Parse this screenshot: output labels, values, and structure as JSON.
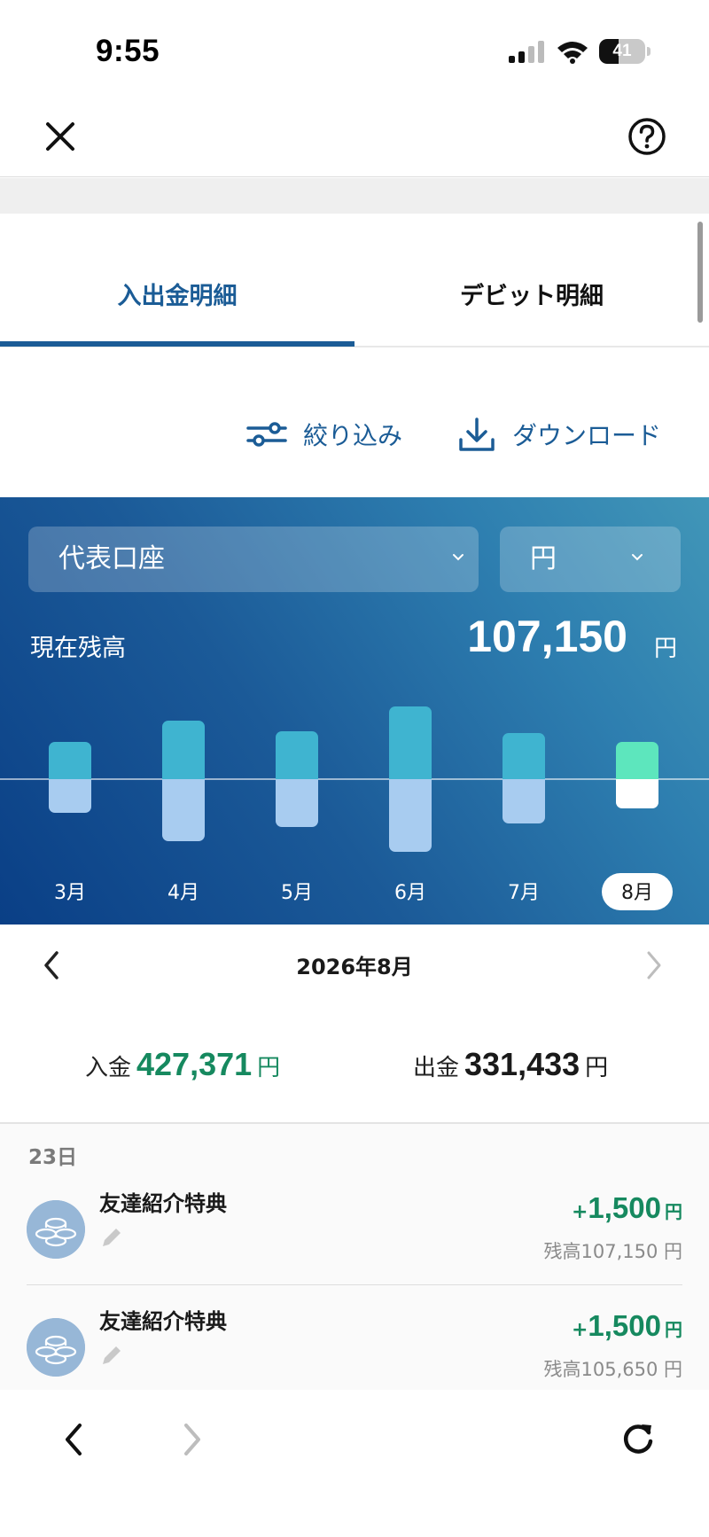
{
  "status_bar": {
    "time": "9:55",
    "battery": "41"
  },
  "tabs": [
    {
      "label": "入出金明細",
      "active": true
    },
    {
      "label": "デビット明細",
      "active": false
    }
  ],
  "actions": {
    "filter_label": "絞り込み",
    "download_label": "ダウンロード"
  },
  "account": {
    "name": "代表口座",
    "currency": "円",
    "balance_label": "現在残高",
    "balance": "107,150",
    "balance_unit": "円"
  },
  "chart_data": {
    "type": "bar",
    "categories": [
      "3月",
      "4月",
      "5月",
      "6月",
      "7月",
      "8月"
    ],
    "selected": "8月",
    "series": [
      {
        "values": [
          42,
          66,
          54,
          82,
          52,
          42
        ]
      },
      {
        "values": [
          38,
          70,
          54,
          82,
          50,
          33
        ]
      }
    ],
    "colors": {
      "deposit": "#3fb4d0",
      "withdrawal": "#a8ccf0",
      "current_deposit": "#5de6bd",
      "current_withdrawal": "#ffffff"
    }
  },
  "month_nav": {
    "title": "2026年8月"
  },
  "summary": {
    "income_label": "入金",
    "income_value": "427,371",
    "income_unit": "円",
    "expense_label": "出金",
    "expense_value": "331,433",
    "expense_unit": "円"
  },
  "transactions": {
    "date": "23日",
    "items": [
      {
        "title": "友達紹介特典",
        "sign": "+",
        "amount": "1,500",
        "unit": "円",
        "balance": "残高107,150 円"
      },
      {
        "title": "友達紹介特典",
        "sign": "+",
        "amount": "1,500",
        "unit": "円",
        "balance": "残高105,650 円"
      }
    ]
  },
  "colors": {
    "accent": "#1b5c96",
    "positive": "#16895f"
  }
}
